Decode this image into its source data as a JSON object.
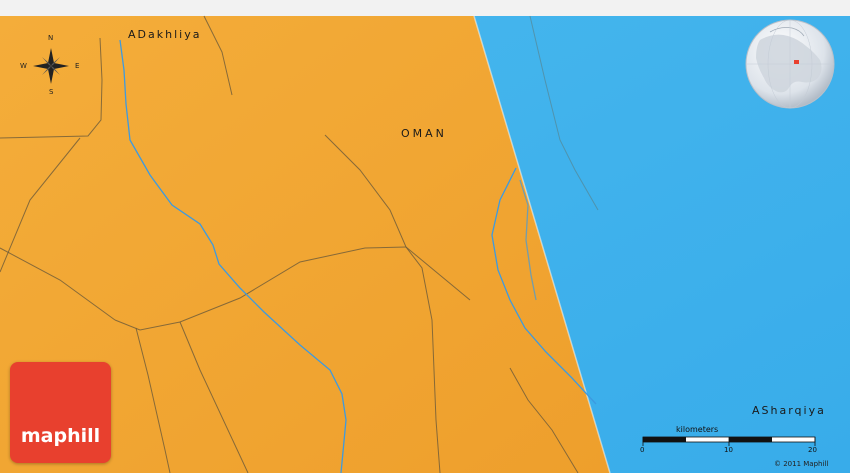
{
  "regions": {
    "dakhliya": "ADakhliya",
    "sharqiya": "ASharqiya"
  },
  "country": "OMAN",
  "compass": {
    "north": "N",
    "south": "S",
    "east": "E",
    "west": "W"
  },
  "logo": {
    "text": "maphill"
  },
  "scale": {
    "title": "kilometers",
    "ticks": [
      "0",
      "10",
      "20"
    ]
  },
  "copyright": "© 2011 Maphill",
  "colors": {
    "land": "#f2a733",
    "sea": "#3eb3ec",
    "river": "#3d9ae0",
    "border": "#6b5a3a",
    "logo": "#e8402e"
  },
  "icons": {
    "compass": "compass-rose-icon",
    "globe": "locator-globe-icon"
  }
}
